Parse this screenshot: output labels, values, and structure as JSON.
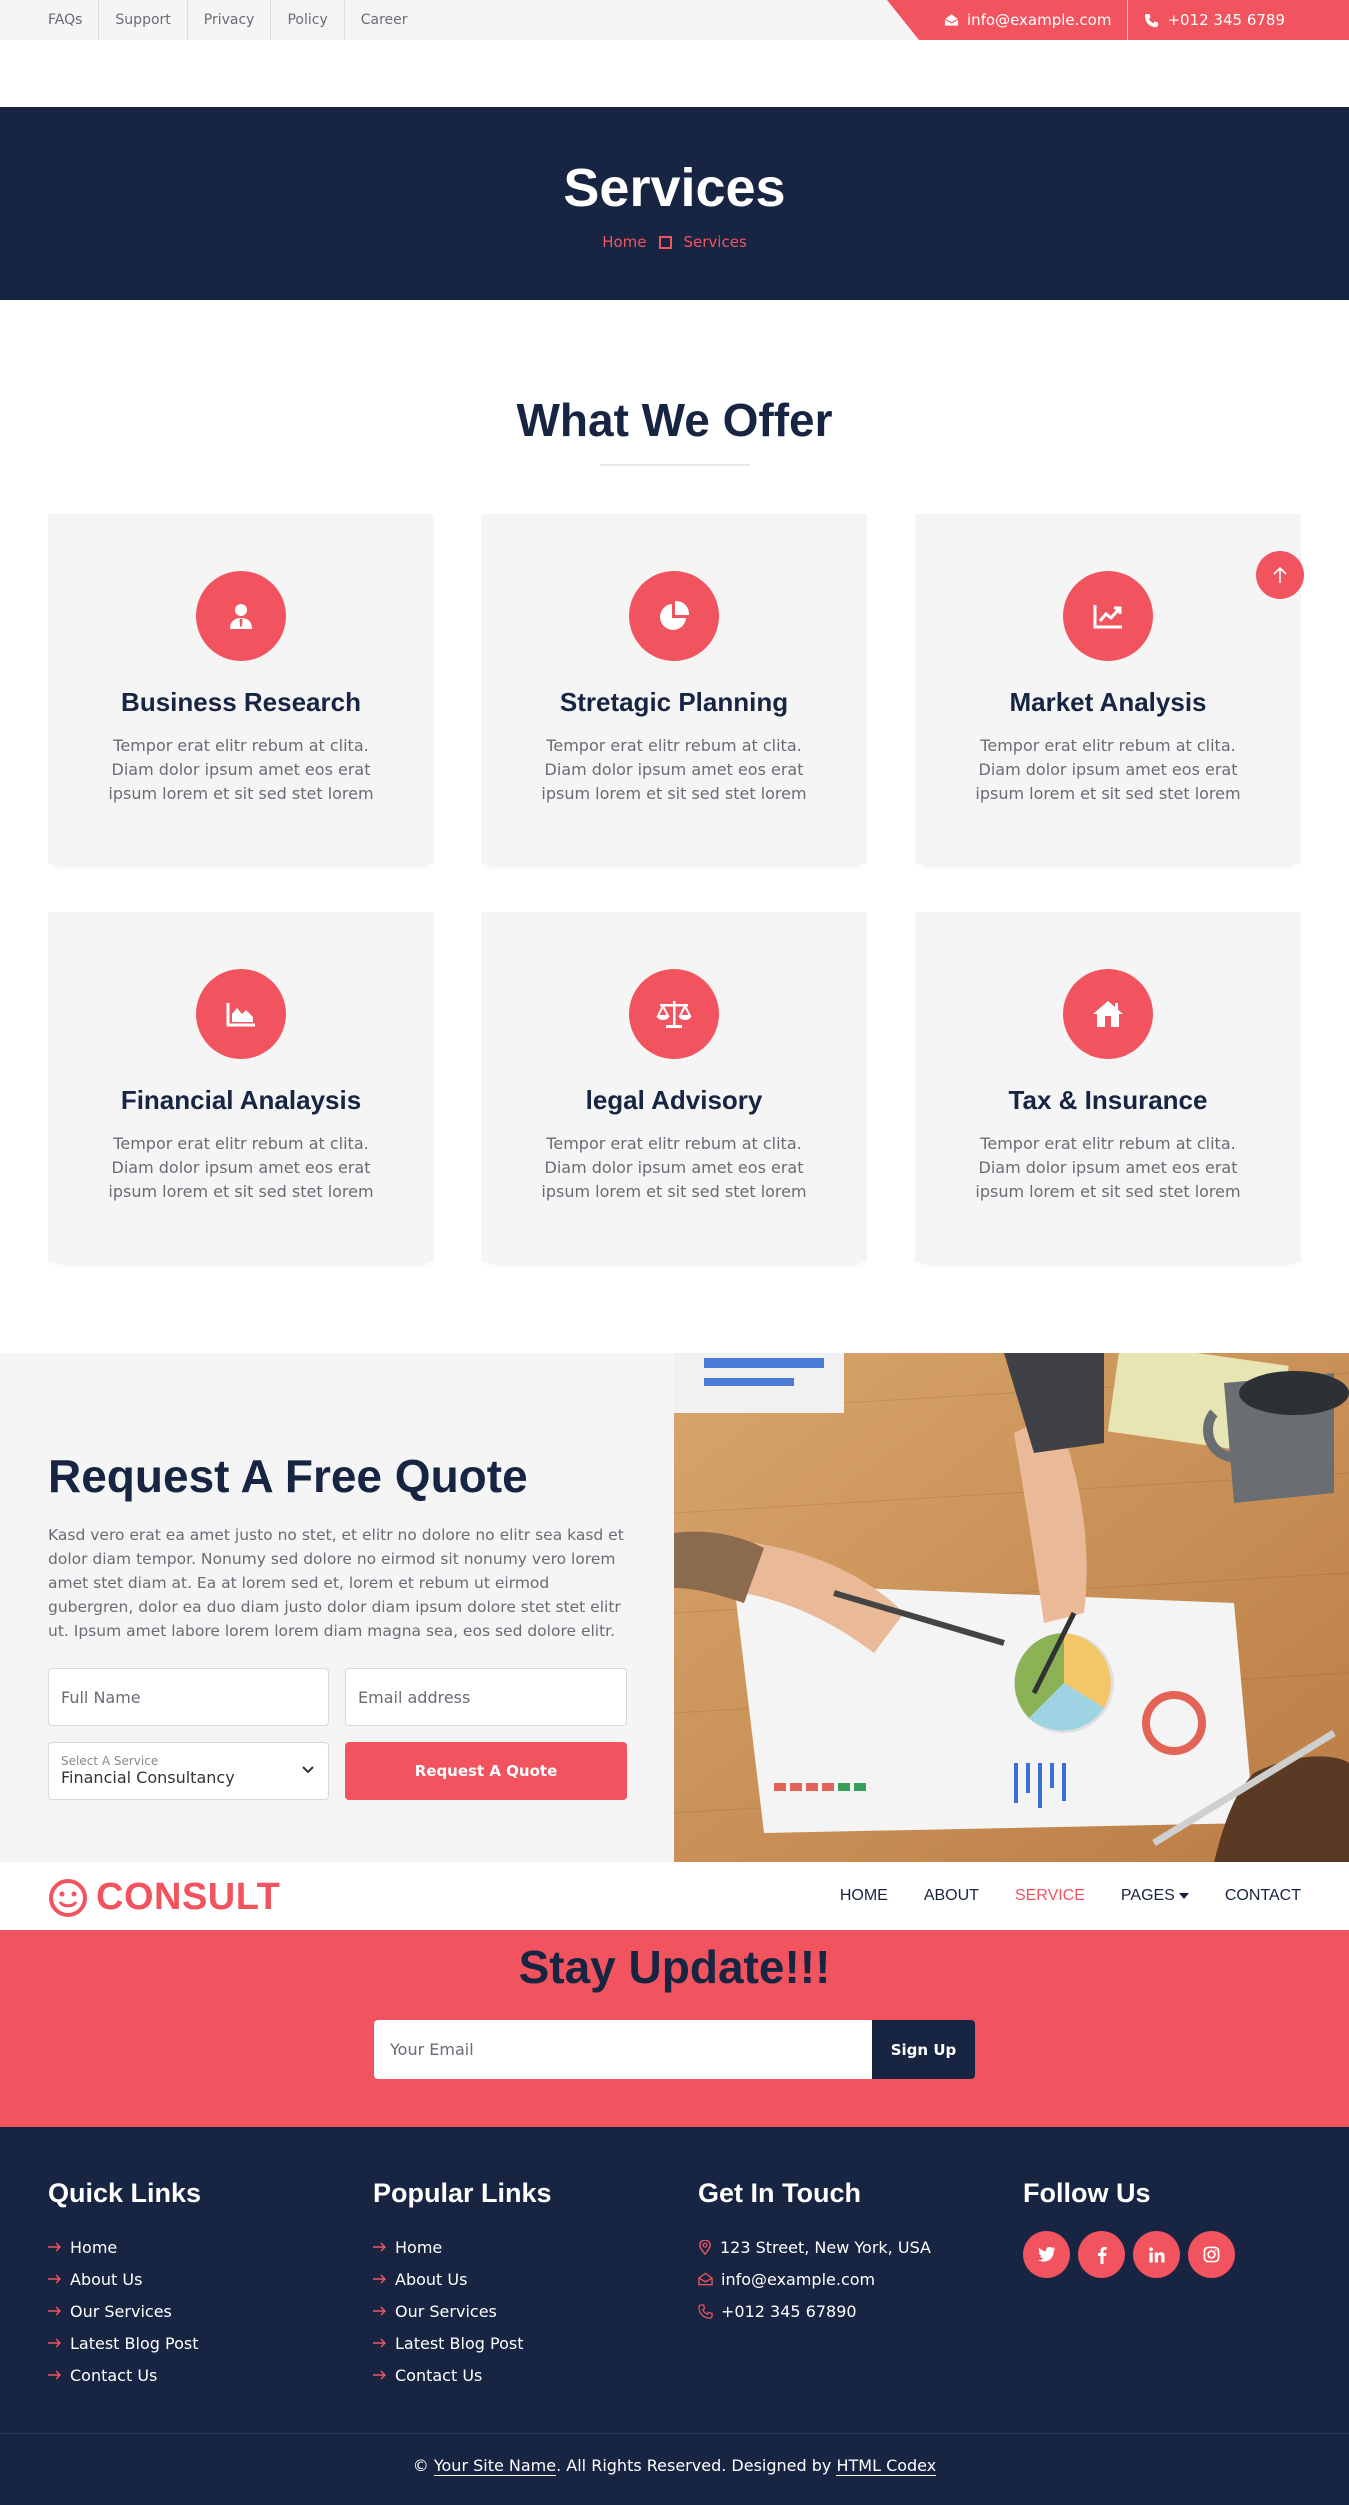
{
  "topbar": {
    "links": [
      "FAQs",
      "Support",
      "Privacy",
      "Policy",
      "Career"
    ],
    "email": "info@example.com",
    "phone": "+012 345 6789"
  },
  "page_header": {
    "title": "Services",
    "breadcrumb": [
      "Home",
      "Services"
    ]
  },
  "offer": {
    "title": "What We Offer",
    "services": [
      {
        "title": "Business Research",
        "text": "Tempor erat elitr rebum at clita. Diam dolor ipsum amet eos erat ipsum lorem et sit sed stet lorem",
        "icon": "user-tie-icon"
      },
      {
        "title": "Stretagic Planning",
        "text": "Tempor erat elitr rebum at clita. Diam dolor ipsum amet eos erat ipsum lorem et sit sed stet lorem",
        "icon": "pie-chart-icon"
      },
      {
        "title": "Market Analysis",
        "text": "Tempor erat elitr rebum at clita. Diam dolor ipsum amet eos erat ipsum lorem et sit sed stet lorem",
        "icon": "line-chart-icon"
      },
      {
        "title": "Financial Analaysis",
        "text": "Tempor erat elitr rebum at clita. Diam dolor ipsum amet eos erat ipsum lorem et sit sed stet lorem",
        "icon": "area-chart-icon"
      },
      {
        "title": "legal Advisory",
        "text": "Tempor erat elitr rebum at clita. Diam dolor ipsum amet eos erat ipsum lorem et sit sed stet lorem",
        "icon": "balance-scale-icon"
      },
      {
        "title": "Tax & Insurance",
        "text": "Tempor erat elitr rebum at clita. Diam dolor ipsum amet eos erat ipsum lorem et sit sed stet lorem",
        "icon": "house-icon"
      }
    ]
  },
  "quote": {
    "title": "Request A Free Quote",
    "text": "Kasd vero erat ea amet justo no stet, et elitr no dolore no elitr sea kasd et dolor diam tempor. Nonumy sed dolore no eirmod sit nonumy vero lorem amet stet diam at. Ea at lorem sed et, lorem et rebum ut eirmod gubergren, dolor ea duo diam justo dolor diam ipsum dolore stet stet elitr ut. Ipsum amet labore lorem lorem diam magna sea, eos sed dolore elitr.",
    "name_placeholder": "Full Name",
    "email_placeholder": "Email address",
    "select_label": "Select A Service",
    "select_value": "Financial Consultancy",
    "button": "Request A Quote"
  },
  "navbar": {
    "brand": "CONSULT",
    "items": [
      "HOME",
      "ABOUT",
      "SERVICE",
      "PAGES",
      "CONTACT"
    ],
    "active": "SERVICE"
  },
  "newsletter": {
    "title": "Stay Update!!!",
    "placeholder": "Your Email",
    "button": "Sign Up"
  },
  "footer": {
    "quick_title": "Quick Links",
    "quick_links": [
      "Home",
      "About Us",
      "Our Services",
      "Latest Blog Post",
      "Contact Us"
    ],
    "popular_title": "Popular Links",
    "popular_links": [
      "Home",
      "About Us",
      "Our Services",
      "Latest Blog Post",
      "Contact Us"
    ],
    "touch_title": "Get In Touch",
    "address": "123 Street, New York, USA",
    "email": "info@example.com",
    "phone": "+012 345 67890",
    "follow_title": "Follow Us",
    "social": [
      "twitter-icon",
      "facebook-icon",
      "linkedin-icon",
      "instagram-icon"
    ],
    "copyright_prefix": "©",
    "site_name": "Your Site Name",
    "rights": ". All Rights Reserved. Designed by",
    "designer": "HTML Codex"
  },
  "colors": {
    "accent": "#f2545f",
    "dark": "#172442",
    "light": "#f5f5f5"
  }
}
